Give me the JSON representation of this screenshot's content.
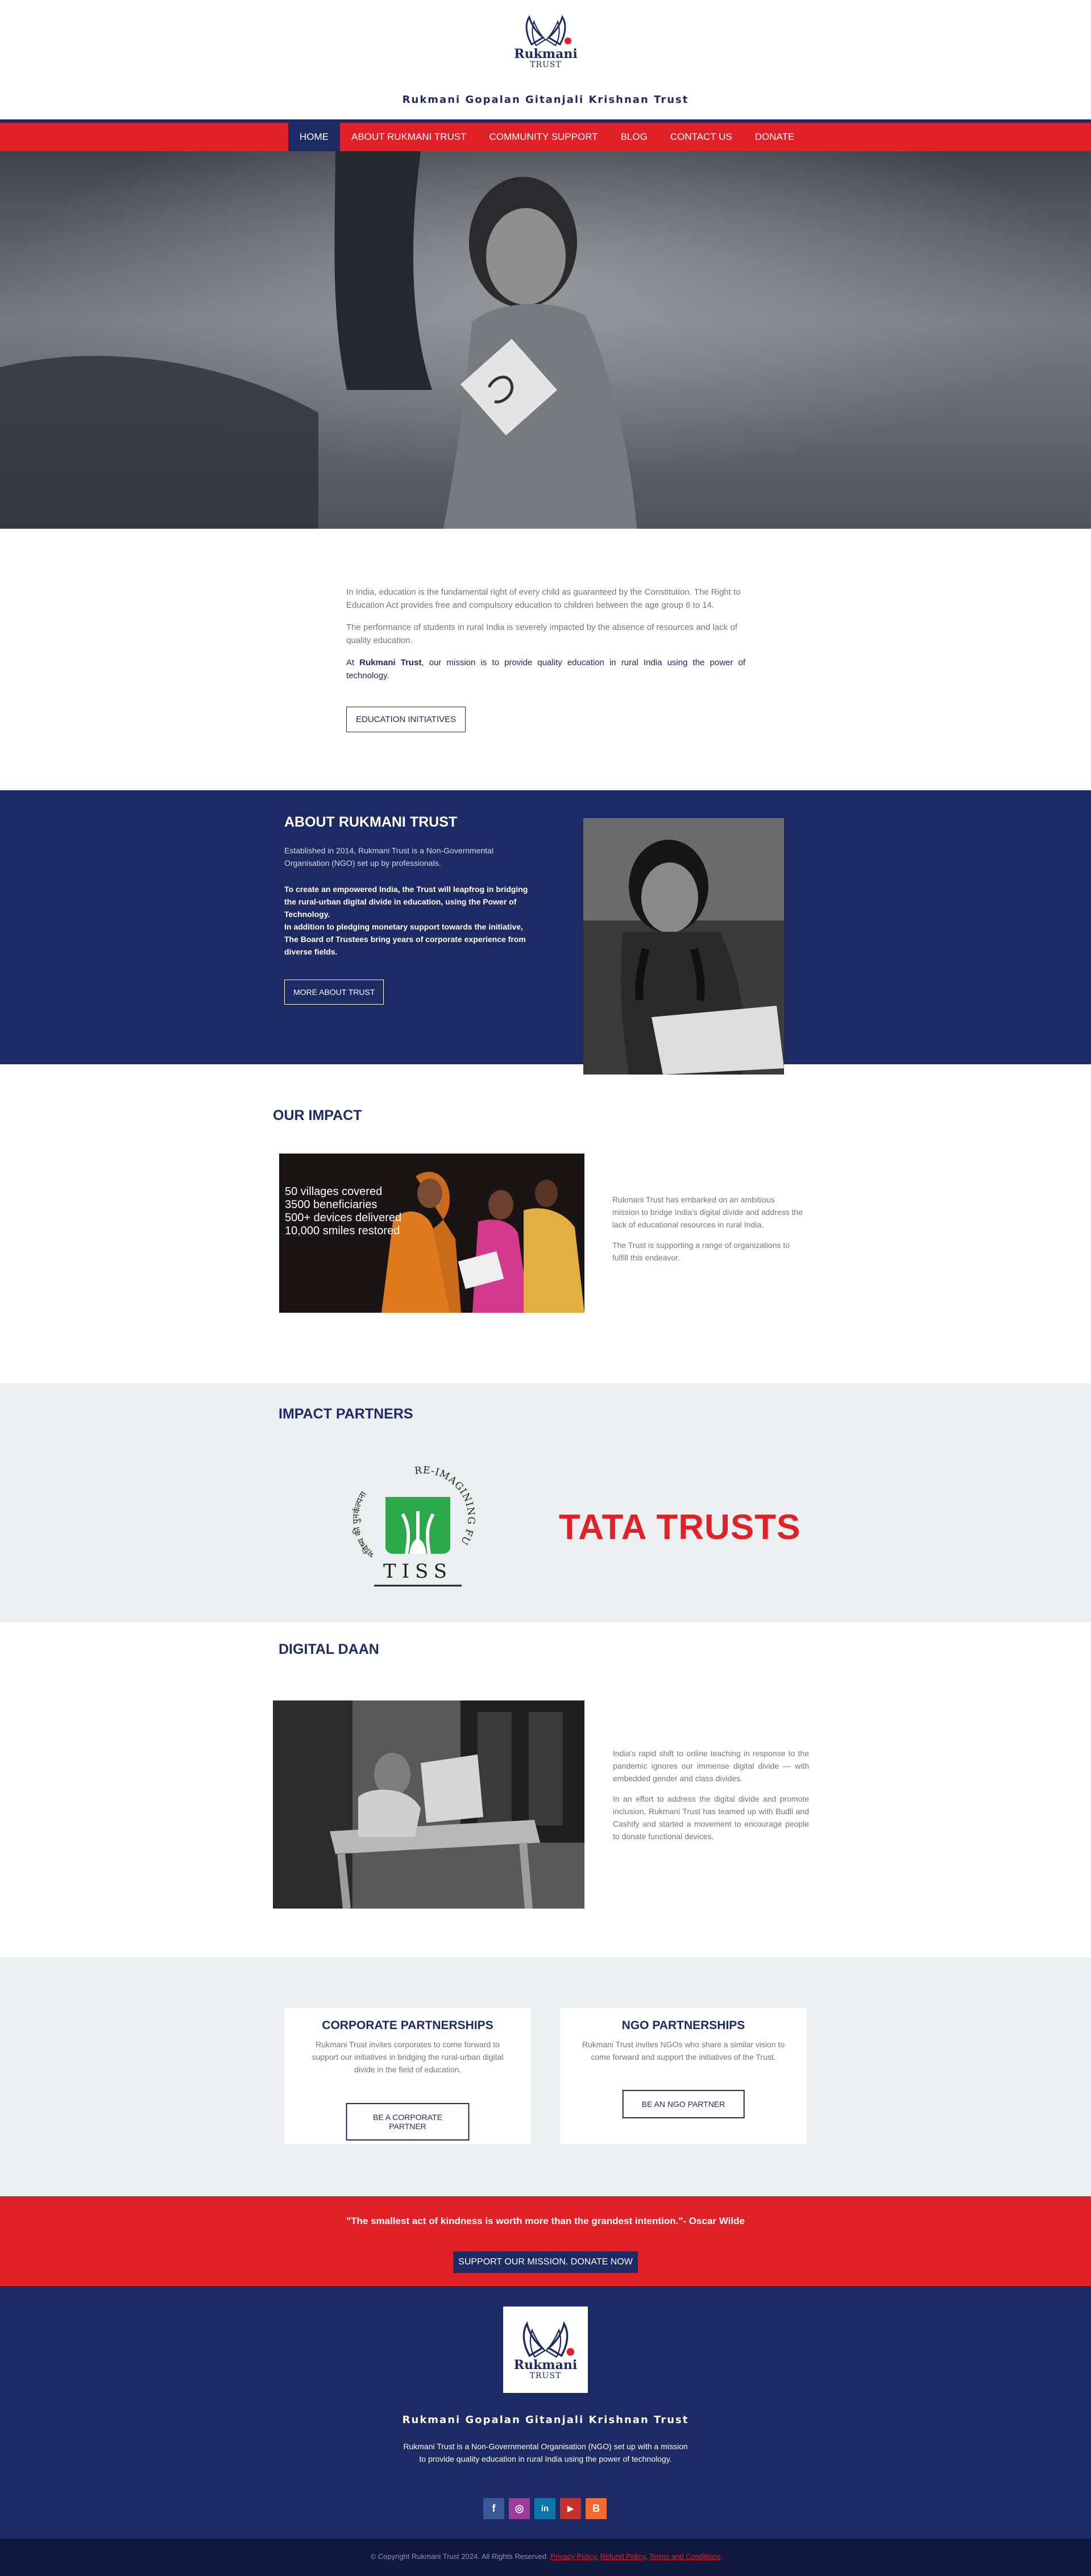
{
  "header": {
    "logo_word": "Rukmani",
    "logo_sub": "TRUST",
    "site_title": "Rukmani Gopalan Gitanjali Krishnan Trust"
  },
  "nav": {
    "items": [
      "HOME",
      "ABOUT RUKMANI TRUST",
      "COMMUNITY SUPPORT",
      "BLOG",
      "CONTACT US",
      "DONATE"
    ],
    "active": "HOME"
  },
  "intro": {
    "p1": "In India, education is the fundamental right of every child as guaranteed by the Constitution. The Right to Education Act provides free and compulsory education to children between the age group 6 to 14.",
    "p2": "The performance of students in rural India is severely impacted by the absence of resources and lack of quality education.",
    "mission_prefix": "At ",
    "mission_name": "Rukmani Trust",
    "mission_rest": ", our mission is to provide quality education in rural India using the power of technology.",
    "button": "EDUCATION INITIATIVES"
  },
  "about": {
    "title": "ABOUT RUKMANI TRUST",
    "established": "Established in 2014, Rukmani Trust is a Non-Governmental Organisation (NGO) set up by professionals.",
    "lead1": "To create an empowered India, the Trust will leapfrog in bridging the rural-urban digital divide in education, using the Power of Technology.",
    "lead2": "In addition to pledging monetary support towards the initiative, The Board of Trustees bring years of corporate experience from diverse fields.",
    "button": "MORE ABOUT TRUST"
  },
  "impact": {
    "title": "OUR IMPACT",
    "stats": [
      "50 villages covered",
      "3500 beneficiaries",
      "500+ devices delivered",
      "10,000 smiles restored"
    ],
    "p1": "Rukmani Trust has embarked on an ambitious mission to bridge India's digital divide and address the lack of educational resources in rural India.",
    "p2": "The Trust is supporting a range of organizations to fulfill this endeavor."
  },
  "partners": {
    "title": "IMPACT PARTNERS",
    "tiss_text": "TISS",
    "tiss_arc": "RE-IMAGINING FUTURES",
    "tiss_hindi": "भविष्य की पुनर्कल्पना",
    "tata": "TATA TRUSTS"
  },
  "digital_daan": {
    "title": "DIGITAL DAAN",
    "p1": "India's rapid shift to online teaching in response to the pandemic ignores our immense digital divide — with embedded gender and class divides.",
    "p2": "In an effort to address the digital divide and promote inclusion, Rukmani Trust has teamed up with Budli and Cashify and started a movement to encourage people to donate functional devices."
  },
  "partnerships": {
    "corporate": {
      "title": "CORPORATE PARTNERSHIPS",
      "text": "Rukmani Trust invites corporates to come forward to support our initiatives in bridging the rural-urban digital divide in the field of education.",
      "button": "BE A CORPORATE PARTNER"
    },
    "ngo": {
      "title": "NGO PARTNERSHIPS",
      "text": "Rukmani Trust invites NGOs who share a similar vision to come forward and support the initiatives of the Trust.",
      "button": "BE AN NGO PARTNER"
    }
  },
  "quote": {
    "text": "\"The smallest act of kindness is worth more than the grandest intention.\"- Oscar Wilde",
    "button": "SUPPORT OUR MISSION. DONATE NOW"
  },
  "footer": {
    "title": "Rukmani Gopalan Gitanjali Krishnan Trust",
    "description": "Rukmani Trust is a Non-Governmental Organisation (NGO) set up with a mission to provide quality education in rural India using the power of technology.",
    "social": [
      {
        "icon": "facebook-icon",
        "glyph": "f",
        "color": "#3b5998"
      },
      {
        "icon": "instagram-icon",
        "glyph": "◎",
        "color": "#9c3b9b"
      },
      {
        "icon": "linkedin-icon",
        "glyph": "in",
        "color": "#0e76a8"
      },
      {
        "icon": "youtube-icon",
        "glyph": "▶",
        "color": "#c4302b"
      },
      {
        "icon": "blogger-icon",
        "glyph": "B",
        "color": "#f06a35"
      }
    ],
    "copyright": "© Copyright Rukmani Trust 2024. All Rights Reserved.",
    "links": [
      "Privacy Policy",
      "Refund Policy",
      "Terms and Conditions"
    ]
  },
  "colors": {
    "navy": "#1d2a63",
    "red": "#e02228",
    "light_gray": "#eceff0"
  }
}
